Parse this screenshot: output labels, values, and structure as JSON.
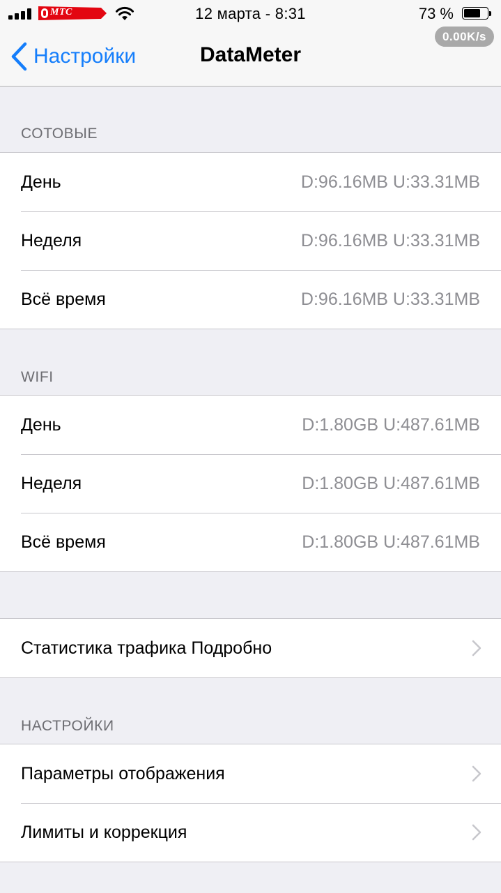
{
  "status_bar": {
    "carrier": "МТС",
    "time": "12 марта - 8:31",
    "battery_percent": "73 %",
    "battery_level": 0.73,
    "speed": "0.00K/s"
  },
  "nav": {
    "back_label": "Настройки",
    "title": "DataMeter"
  },
  "cellular": {
    "header": "СОТОВЫЕ",
    "rows": [
      {
        "label": "День",
        "value": "D:96.16MB U:33.31MB"
      },
      {
        "label": "Неделя",
        "value": "D:96.16MB U:33.31MB"
      },
      {
        "label": "Всё время",
        "value": "D:96.16MB U:33.31MB"
      }
    ]
  },
  "wifi": {
    "header": "WIFI",
    "rows": [
      {
        "label": "День",
        "value": "D:1.80GB U:487.61MB"
      },
      {
        "label": "Неделя",
        "value": "D:1.80GB U:487.61MB"
      },
      {
        "label": "Всё время",
        "value": "D:1.80GB U:487.61MB"
      }
    ]
  },
  "stats": {
    "label": "Статистика трафика Подробно"
  },
  "settings": {
    "header": "НАСТРОЙКИ",
    "rows": [
      {
        "label": "Параметры отображения"
      },
      {
        "label": "Лимиты и коррекция"
      }
    ]
  },
  "colors": {
    "accent": "#157efb",
    "carrier_red": "#e30611",
    "background": "#efeff4",
    "secondary_text": "#8e8e93"
  },
  "icons": {
    "signal": "cellular-signal-icon",
    "wifi": "wifi-icon",
    "battery": "battery-icon",
    "back": "chevron-left-icon",
    "disclosure": "chevron-right-icon"
  }
}
